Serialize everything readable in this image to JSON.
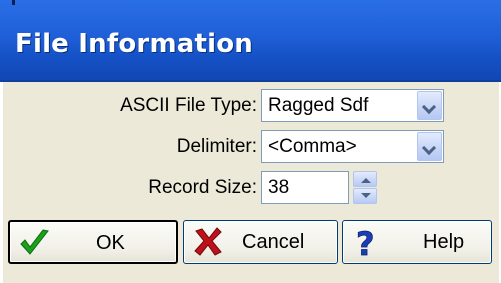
{
  "window": {
    "title": "File Information"
  },
  "form": {
    "ascii_file_type": {
      "label": "ASCII File Type:",
      "value": "Ragged Sdf"
    },
    "delimiter": {
      "label": "Delimiter:",
      "value": "<Comma>"
    },
    "record_size": {
      "label": "Record Size:",
      "value": "38"
    }
  },
  "buttons": {
    "ok": {
      "label": "OK",
      "icon": "checkmark-icon",
      "color": "#1aa01a"
    },
    "cancel": {
      "label": "Cancel",
      "icon": "x-icon",
      "color": "#c0101a"
    },
    "help": {
      "label": "Help",
      "icon": "question-mark-icon",
      "color": "#1a3fb5"
    }
  },
  "colors": {
    "title_bar": "#1f5fd8",
    "dialog_background": "#ece9d8"
  }
}
